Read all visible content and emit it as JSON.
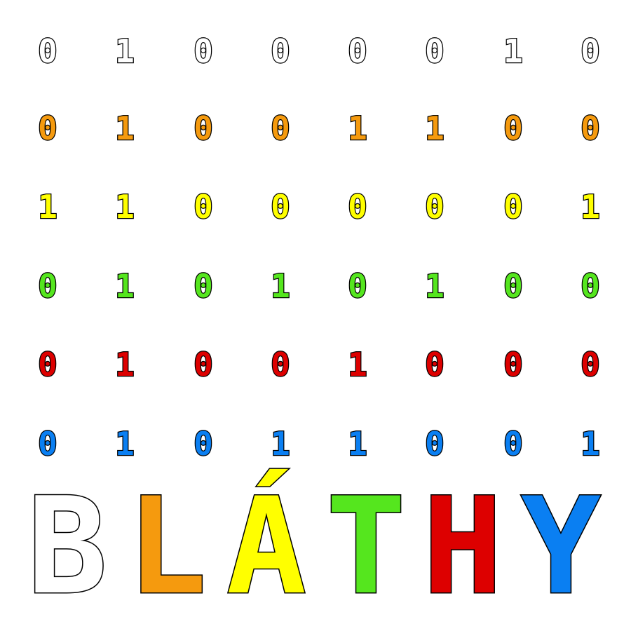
{
  "grid": {
    "rows": [
      {
        "color": "#ffffff",
        "bits": [
          "0",
          "1",
          "0",
          "0",
          "0",
          "0",
          "1",
          "0"
        ]
      },
      {
        "color": "#f59a0e",
        "bits": [
          "0",
          "1",
          "0",
          "0",
          "1",
          "1",
          "0",
          "0"
        ]
      },
      {
        "color": "#ffff00",
        "bits": [
          "1",
          "1",
          "0",
          "0",
          "0",
          "0",
          "0",
          "1"
        ]
      },
      {
        "color": "#55e61e",
        "bits": [
          "0",
          "1",
          "0",
          "1",
          "0",
          "1",
          "0",
          "0"
        ]
      },
      {
        "color": "#dd0000",
        "bits": [
          "0",
          "1",
          "0",
          "0",
          "1",
          "0",
          "0",
          "0"
        ]
      },
      {
        "color": "#0a7ff2",
        "bits": [
          "0",
          "1",
          "0",
          "1",
          "1",
          "0",
          "0",
          "1"
        ]
      }
    ]
  },
  "word": {
    "letters": [
      {
        "char": "B",
        "color": "#ffffff"
      },
      {
        "char": "L",
        "color": "#f59a0e"
      },
      {
        "char": "Á",
        "color": "#ffff00"
      },
      {
        "char": "T",
        "color": "#55e61e"
      },
      {
        "char": "H",
        "color": "#dd0000"
      },
      {
        "char": "Y",
        "color": "#0a7ff2"
      }
    ]
  }
}
